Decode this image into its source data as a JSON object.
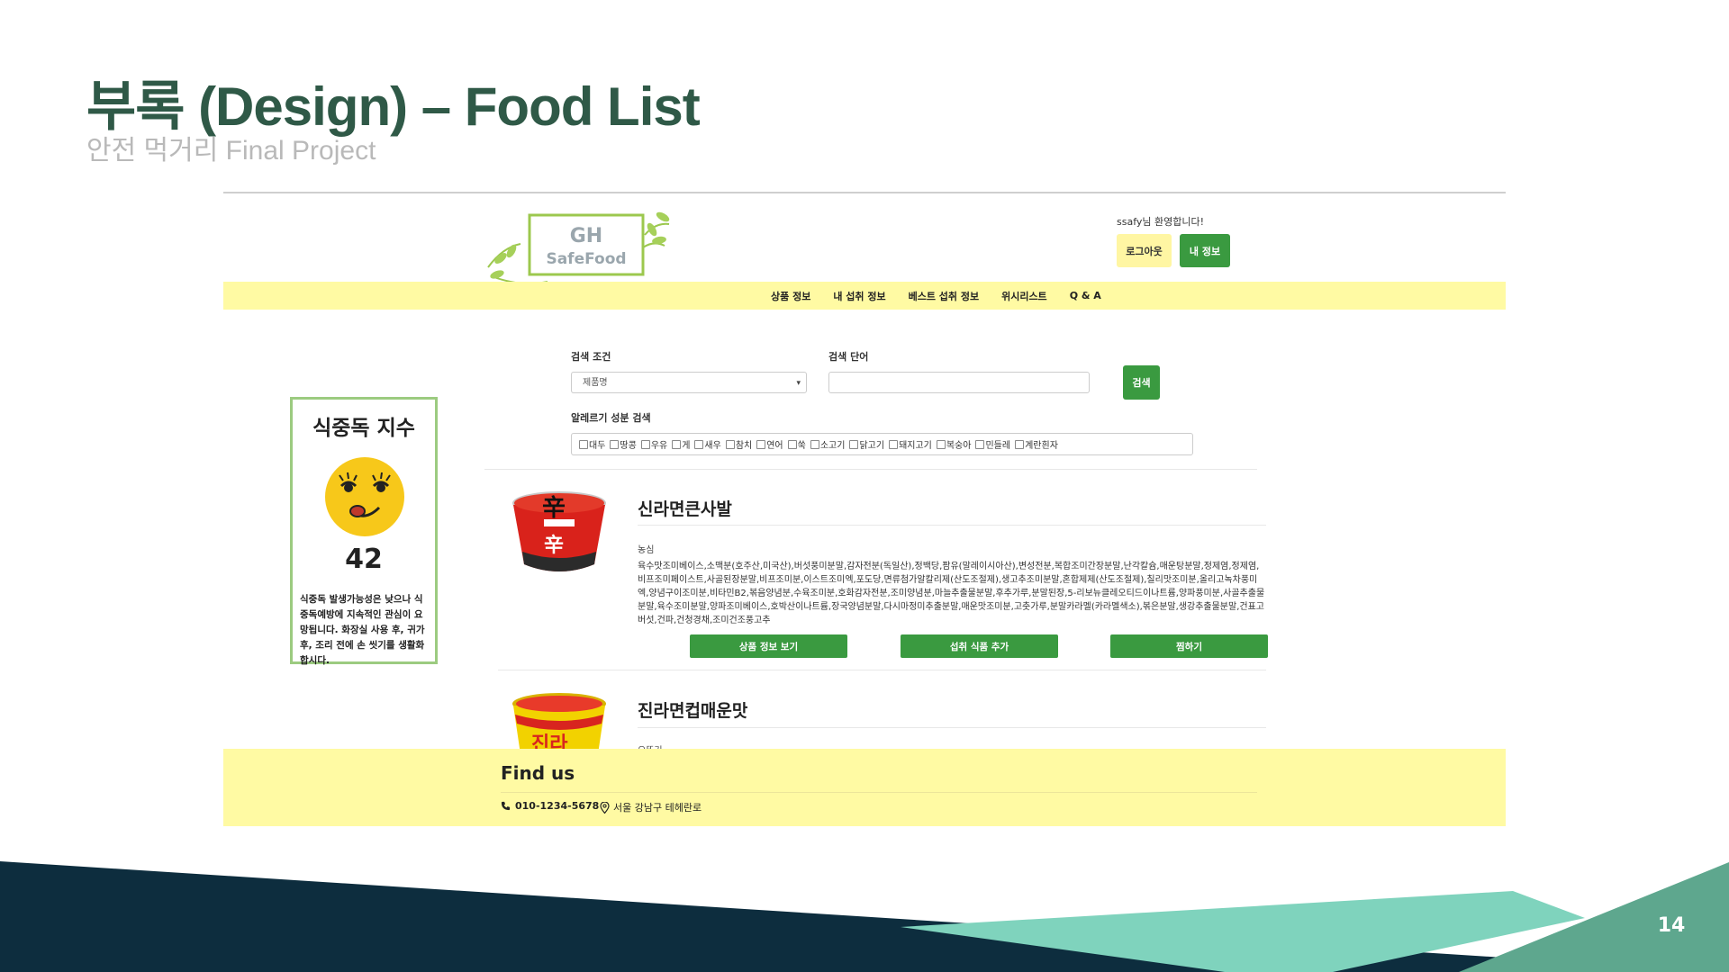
{
  "slide": {
    "title": "부록 (Design) – Food List",
    "subtitle": "안전 먹거리 Final Project",
    "page_number": "14"
  },
  "header": {
    "logo_line1": "GH",
    "logo_line2": "SafeFood",
    "welcome": "ssafy님 환영합니다!",
    "logout_label": "로그아웃",
    "myinfo_label": "내 정보"
  },
  "nav": {
    "items": [
      "상품 정보",
      "내 섭취 정보",
      "베스트 섭취 정보",
      "위시리스트",
      "Q & A"
    ]
  },
  "search": {
    "condition_label": "검색 조건",
    "condition_value": "제품명",
    "keyword_label": "검색 단어",
    "keyword_value": "",
    "button_label": "검색",
    "allergy_label": "알레르기 성분 검색",
    "allergies": [
      "대두",
      "땅콩",
      "우유",
      "게",
      "새우",
      "참치",
      "연어",
      "쑥",
      "소고기",
      "닭고기",
      "돼지고기",
      "복숭아",
      "민들레",
      "계란흰자"
    ]
  },
  "index_card": {
    "title": "식중독 지수",
    "value": "42",
    "description": "식중독 발생가능성은 낮으나 식중독예방에 지속적인 관심이 요망됩니다. 화장실 사용 후, 귀가 후, 조리 전에 손 씻기를 생활화 합시다."
  },
  "products": [
    {
      "name": "신라면큰사발",
      "maker": "농심",
      "ingredients": "육수맛조미베이스,소맥분(호주산,미국산),버섯풍미분말,감자전분(독일산),정백당,팜유(말레이시아산),변성전분,복합조미간장분말,난각칼슘,매운탕분말,정제염,정제염,비프조미페이스트,사골된장분말,비프조미분,이스트조미엑,포도당,면류첨가알칼리제(산도조절제),생고추조미분말,혼합제제(산도조절제),칠리맛조미분,올리고녹차풍미엑,양념구이조미분,비타민B2,볶음양념분,수육조미분,호화감자전분,조미양념분,마늘추출물분말,후추가루,분말된장,5-리보뉴클레오티드이나트륨,양파풍미분,사골추출물분말,육수조미분말,양파조미베이스,호박산이나트륨,장국양념분말,다시마정미추출분말,매운맛조미분,고춧가루,분말카라멜(카라멜색소),볶은분말,생강추출물분말,건표고버섯,건파,건청경채,조미건조풍고추",
      "buttons": [
        "상품 정보 보기",
        "섭취 식품 추가",
        "찜하기"
      ]
    },
    {
      "name": "진라면컵매운맛",
      "maker": "오뚜기"
    }
  ],
  "footer": {
    "title": "Find us",
    "phone": "010-1234-5678",
    "address": "서울 강남구 테헤란로"
  },
  "colors": {
    "title_green": "#2f5947",
    "accent_green": "#3a9a40",
    "nav_yellow": "#fffaa3",
    "navy": "#0d2d3e",
    "teal_light": "#7fd3bd",
    "teal_dark": "#5ea78e"
  }
}
